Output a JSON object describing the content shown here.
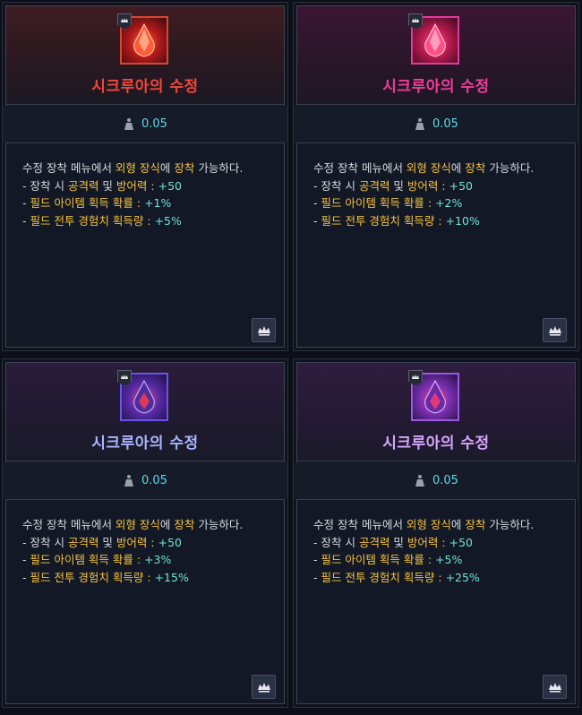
{
  "cards": [
    {
      "title": "시크루아의 수정",
      "weight": "0.05",
      "desc_line1_a": "수정 장착 메뉴에서 ",
      "desc_line1_b": "외형 장식",
      "desc_line1_c": "에 ",
      "desc_line1_d": "장착",
      "desc_line1_e": " 가능하다.",
      "stat1_label": "- 장착 시 ",
      "stat1_name": "공격력",
      "stat1_mid": " 및 ",
      "stat1_name2": "방어력",
      "stat1_sep": " : ",
      "stat1_value": "+50",
      "stat2_label": "- ",
      "stat2_name": "필드 아이템 획득 확률",
      "stat2_sep": " : ",
      "stat2_value": "+1%",
      "stat3_label": "- ",
      "stat3_name": "필드 전투 경험치 획득량",
      "stat3_sep": " : ",
      "stat3_value": "+5%"
    },
    {
      "title": "시크루아의 수정",
      "weight": "0.05",
      "desc_line1_a": "수정 장착 메뉴에서 ",
      "desc_line1_b": "외형 장식",
      "desc_line1_c": "에 ",
      "desc_line1_d": "장착",
      "desc_line1_e": " 가능하다.",
      "stat1_label": "- 장착 시 ",
      "stat1_name": "공격력",
      "stat1_mid": " 및 ",
      "stat1_name2": "방어력",
      "stat1_sep": " : ",
      "stat1_value": "+50",
      "stat2_label": "- ",
      "stat2_name": "필드 아이템 획득 확률",
      "stat2_sep": " : ",
      "stat2_value": "+2%",
      "stat3_label": "- ",
      "stat3_name": "필드 전투 경험치 획득량",
      "stat3_sep": " : ",
      "stat3_value": "+10%"
    },
    {
      "title": "시크루아의 수정",
      "weight": "0.05",
      "desc_line1_a": "수정 장착 메뉴에서 ",
      "desc_line1_b": "외형 장식",
      "desc_line1_c": "에 ",
      "desc_line1_d": "장착",
      "desc_line1_e": " 가능하다.",
      "stat1_label": "- 장착 시 ",
      "stat1_name": "공격력",
      "stat1_mid": " 및 ",
      "stat1_name2": "방어력",
      "stat1_sep": " : ",
      "stat1_value": "+50",
      "stat2_label": "- ",
      "stat2_name": "필드 아이템 획득 확률",
      "stat2_sep": " : ",
      "stat2_value": "+3%",
      "stat3_label": "- ",
      "stat3_name": "필드 전투 경험치 획득량",
      "stat3_sep": " : ",
      "stat3_value": "+15%"
    },
    {
      "title": "시크루아의 수정",
      "weight": "0.05",
      "desc_line1_a": "수정 장착 메뉴에서 ",
      "desc_line1_b": "외형 장식",
      "desc_line1_c": "에 ",
      "desc_line1_d": "장착",
      "desc_line1_e": " 가능하다.",
      "stat1_label": "- 장착 시 ",
      "stat1_name": "공격력",
      "stat1_mid": " 및 ",
      "stat1_name2": "방어력",
      "stat1_sep": " : ",
      "stat1_value": "+50",
      "stat2_label": "- ",
      "stat2_name": "필드 아이템 획득 확률",
      "stat2_sep": " : ",
      "stat2_value": "+5%",
      "stat3_label": "- ",
      "stat3_name": "필드 전투 경험치 획득량",
      "stat3_sep": " : ",
      "stat3_value": "+25%"
    }
  ],
  "icons": {
    "item": "crystal-icon",
    "badge": "crown-icon",
    "weight": "weight-icon",
    "corner": "crown-icon"
  },
  "colors": {
    "title_red": "#f0483a",
    "title_pink": "#ef3d9a",
    "title_blue": "#a9b6ff",
    "title_purple": "#d8a6ff",
    "highlight": "#f5c23a",
    "value": "#6fe3d6"
  }
}
